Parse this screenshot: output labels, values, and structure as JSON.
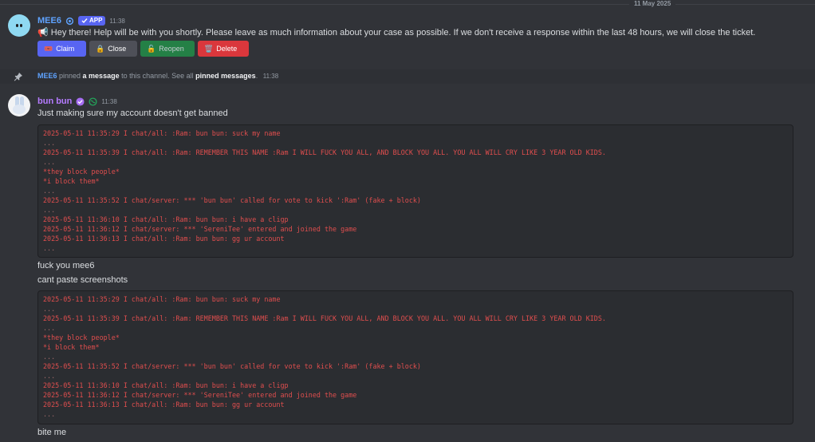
{
  "date_divider": "11 May 2025",
  "mee6_message": {
    "author": "MEE6",
    "badge": "APP",
    "time": "11:38",
    "text": "📢 Hey there! Help will be with you shortly. Please leave as much information about your case as possible. If we don't receive a response within the last 48 hours, we will close the ticket.",
    "buttons": [
      {
        "emoji": "🎟️",
        "label": "Claim"
      },
      {
        "emoji": "🔒",
        "label": "Close"
      },
      {
        "emoji": "🔓",
        "label": "Reopen"
      },
      {
        "emoji": "🗑️",
        "label": "Delete"
      }
    ]
  },
  "pin_notice": {
    "actor": "MEE6",
    "text1": " pinned ",
    "link1": "a message",
    "text2": " to this channel. See all ",
    "link2": "pinned messages",
    "text3": ".",
    "time": "11:38"
  },
  "bun_message": {
    "author": "bun bun",
    "time": "11:38",
    "line1": "Just making sure my account doesn't get banned",
    "line2": "fuck you mee6",
    "line3": "cant paste screenshots",
    "line4": "bite me",
    "code_lines": [
      "2025-05-11 11:35:29 I chat/all: :Ram: bun bun: suck my name",
      "...",
      "2025-05-11 11:35:39 I chat/all: :Ram: REMEMBER THIS NAME :Ram I WILL FUCK YOU ALL, AND BLOCK YOU ALL. YOU ALL WILL CRY LIKE 3 YEAR OLD KIDS.",
      "...",
      "*they block people*",
      "*i block them*",
      "...",
      "2025-05-11 11:35:52 I chat/server: *** 'bun bun' called for vote to kick ':Ram' (fake + block)",
      "...",
      "2025-05-11 11:36:10 I chat/all: :Ram: bun bun: i have a cligp",
      "2025-05-11 11:36:12 I chat/server: *** 'SereniTee' entered and joined the game",
      "2025-05-11 11:36:13 I chat/all: :Ram: bun bun: gg ur account",
      "..."
    ]
  },
  "colors": {
    "background": "#313338",
    "mee6_name": "#5fa3ff",
    "bun_name": "#b57bff",
    "code_text": "#e04e4e"
  }
}
